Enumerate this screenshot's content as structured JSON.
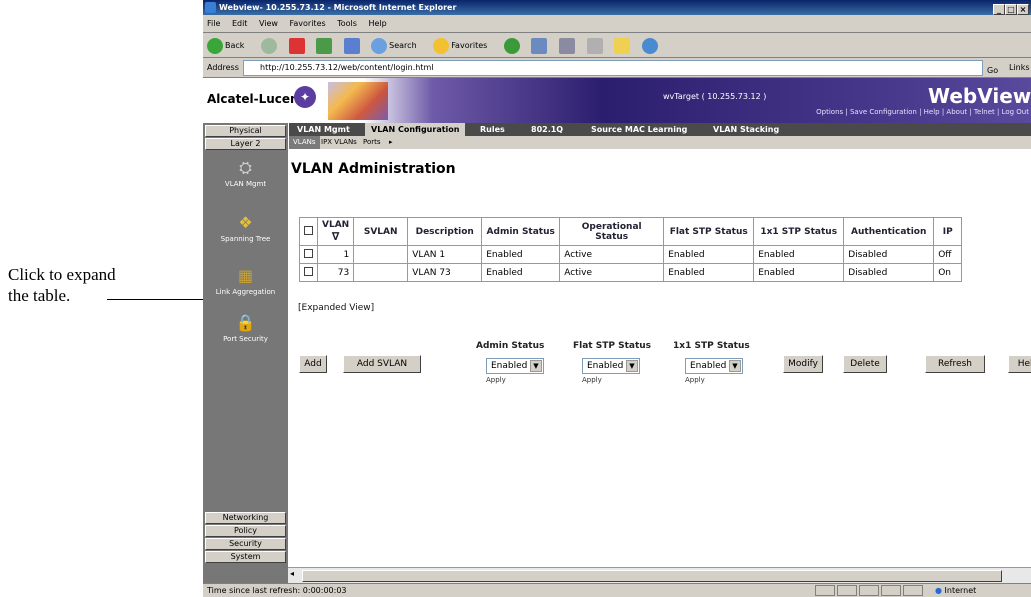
{
  "annotation": {
    "line1": "Click to expand",
    "line2": "the table."
  },
  "browser": {
    "title": "Webview- 10.255.73.12 - Microsoft Internet Explorer",
    "menu": [
      "File",
      "Edit",
      "View",
      "Favorites",
      "Tools",
      "Help"
    ],
    "toolbar": {
      "back": "Back",
      "search": "Search",
      "favorites": "Favorites"
    },
    "address_label": "Address",
    "address": "http://10.255.73.12/web/content/login.html",
    "go": "Go",
    "links": "Links",
    "status_text": "Time since last refresh: 0:00:00:03",
    "zone": "Internet"
  },
  "banner": {
    "logo": "Alcatel-Lucent",
    "target": "wvTarget ( 10.255.73.12 )",
    "app_name": "WebView",
    "top_links": "Options | Save Configuration | Help | About | Telnet | Log Out"
  },
  "sidebar": {
    "top_buttons": [
      "Physical",
      "Layer 2"
    ],
    "icons": [
      {
        "label": "VLAN Mgmt",
        "icon": "vlan-mgmt-icon"
      },
      {
        "label": "Spanning Tree",
        "icon": "spanning-tree-icon"
      },
      {
        "label": "Link Aggregation",
        "icon": "link-aggregation-icon"
      },
      {
        "label": "Port Security",
        "icon": "port-security-icon"
      }
    ],
    "bottom_buttons": [
      "Networking",
      "Policy",
      "Security",
      "System"
    ]
  },
  "tabs": [
    "VLAN Mgmt",
    "VLAN Configuration",
    "Rules",
    "802.1Q",
    "Source MAC Learning",
    "VLAN Stacking"
  ],
  "subtabs": [
    "VLANs",
    "IPX VLANs",
    "Ports"
  ],
  "heading": "VLAN Administration",
  "table": {
    "headers": [
      "",
      "VLAN",
      "SVLAN",
      "Description",
      "Admin Status",
      "Operational Status",
      "Flat STP Status",
      "1x1 STP Status",
      "Authentication",
      "IP"
    ],
    "rows": [
      [
        "",
        "1",
        "",
        "VLAN 1",
        "Enabled",
        "Active",
        "Enabled",
        "Enabled",
        "Disabled",
        "Off"
      ],
      [
        "",
        "73",
        "",
        "VLAN 73",
        "Enabled",
        "Active",
        "Enabled",
        "Enabled",
        "Disabled",
        "On"
      ]
    ]
  },
  "expanded_view": "[Expanded View]",
  "controls": {
    "add": "Add",
    "add_svlan": "Add SVLAN",
    "admin_status_label": "Admin Status",
    "flat_stp_label": "Flat STP Status",
    "stp_1x1_label": "1x1 STP Status",
    "select_value": "Enabled",
    "apply": "Apply",
    "modify": "Modify",
    "delete": "Delete",
    "refresh": "Refresh",
    "help": "Help"
  }
}
